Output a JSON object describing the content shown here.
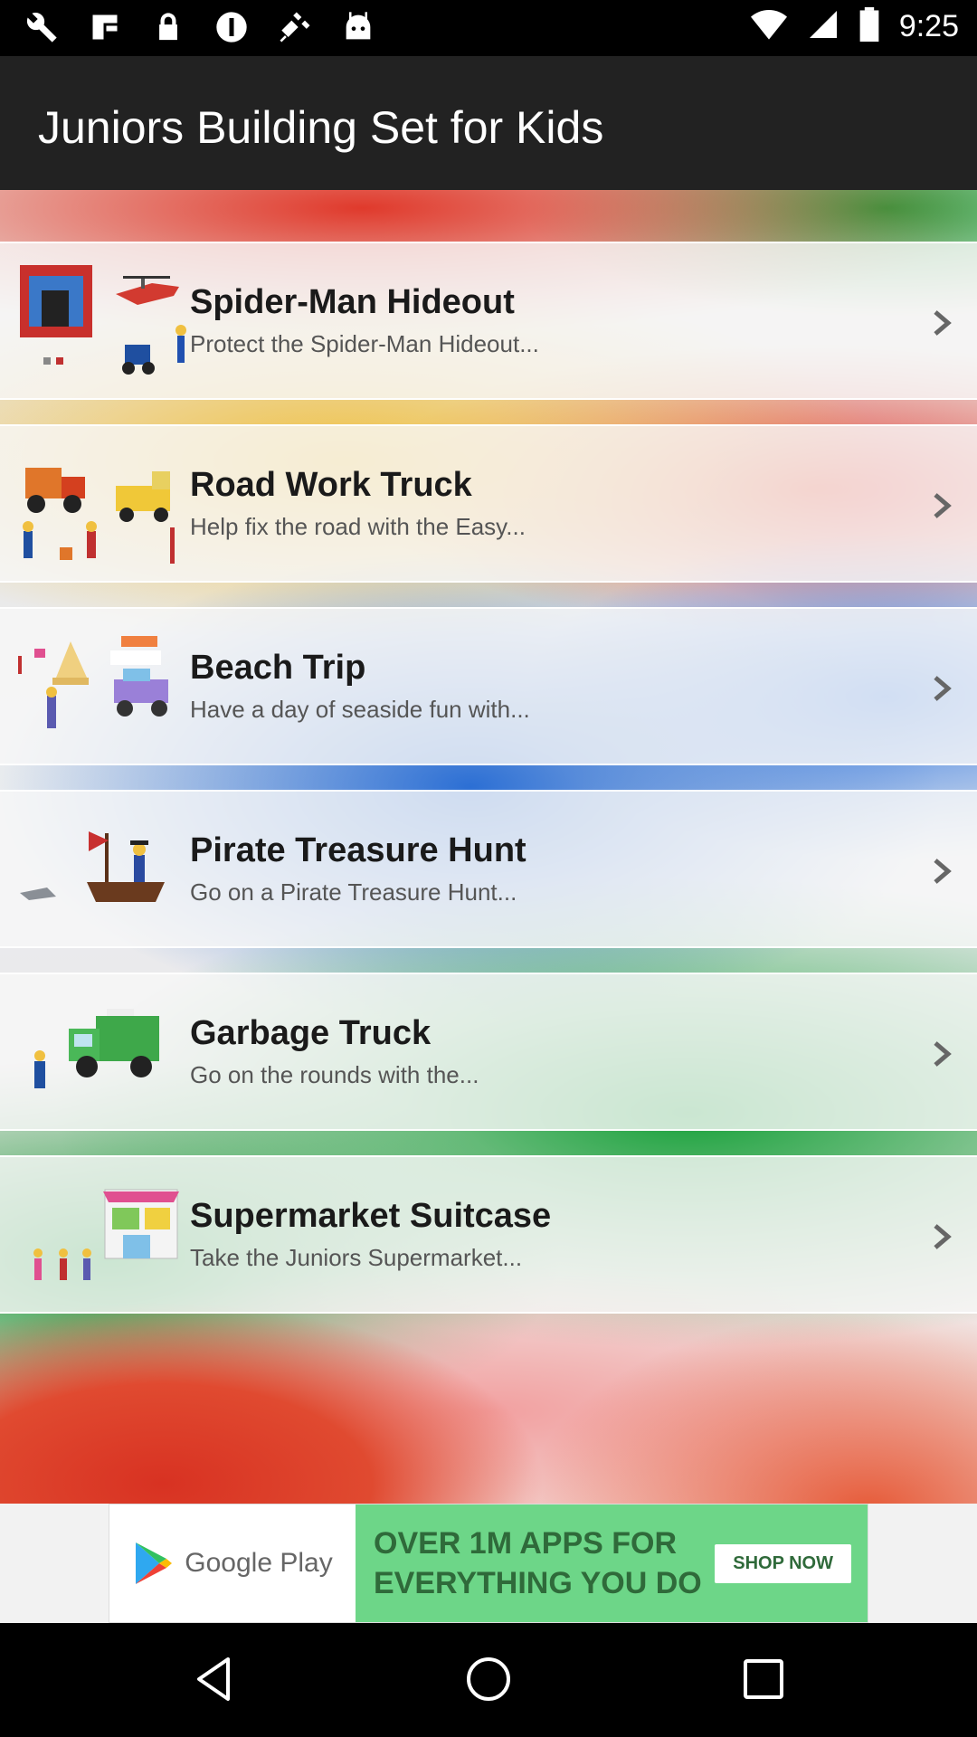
{
  "status_bar": {
    "time": "9:25",
    "icons": [
      "wrench-icon",
      "document-icon",
      "lock-icon",
      "alert-icon",
      "satellite-icon",
      "android-icon"
    ]
  },
  "app_bar": {
    "title": "Juniors Building Set for Kids"
  },
  "items": [
    {
      "title": "Spider-Man Hideout",
      "subtitle": "Protect the Spider-Man Hideout..."
    },
    {
      "title": "Road Work Truck",
      "subtitle": "Help fix the road with the Easy..."
    },
    {
      "title": "Beach Trip",
      "subtitle": "Have a day of seaside fun with..."
    },
    {
      "title": "Pirate Treasure Hunt",
      "subtitle": "Go on a Pirate Treasure Hunt..."
    },
    {
      "title": "Garbage Truck",
      "subtitle": "Go on the rounds with the..."
    },
    {
      "title": "Supermarket Suitcase",
      "subtitle": "Take the Juniors Supermarket..."
    }
  ],
  "ad": {
    "brand": "Google Play",
    "line1": "OVER 1M APPS FOR",
    "line2": "EVERYTHING YOU DO",
    "cta": "SHOP NOW"
  }
}
